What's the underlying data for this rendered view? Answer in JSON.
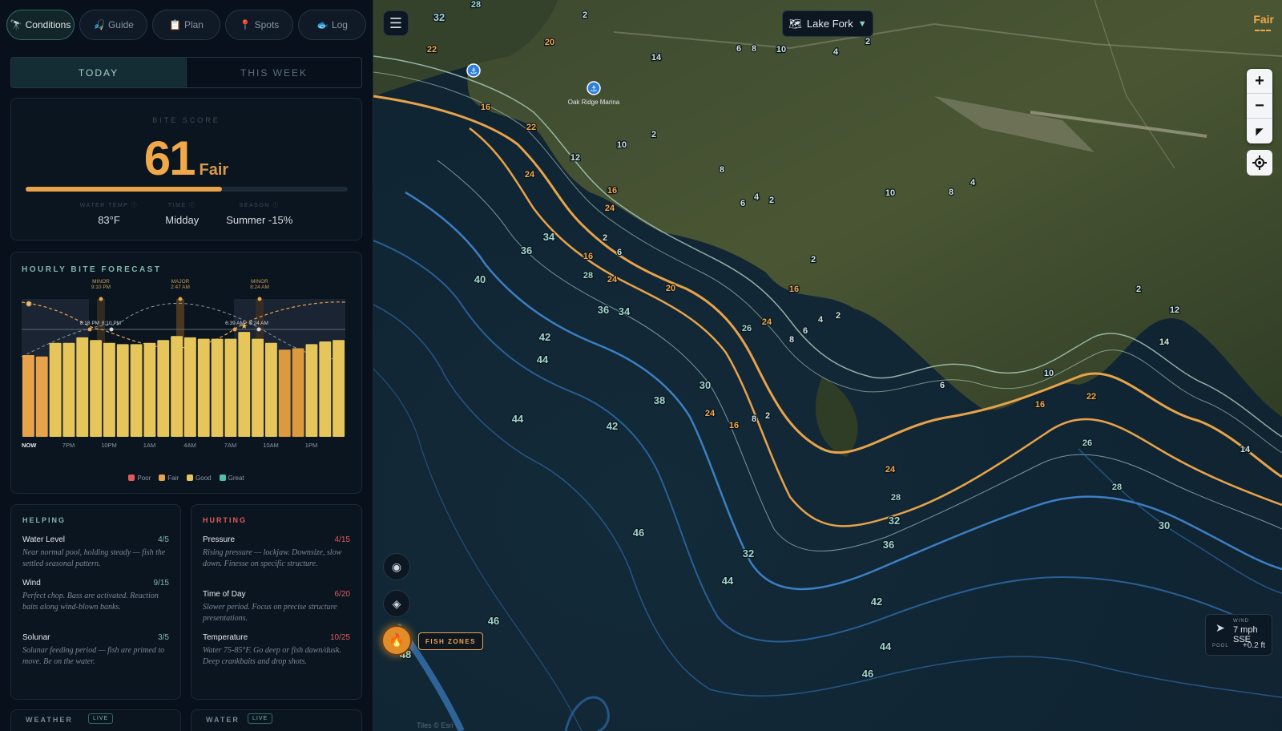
{
  "nav": [
    {
      "label": "Conditions",
      "icon": "🔭",
      "active": true
    },
    {
      "label": "Guide",
      "icon": "🎣",
      "active": false
    },
    {
      "label": "Plan",
      "icon": "📋",
      "active": false
    },
    {
      "label": "Spots",
      "icon": "📍",
      "active": false
    },
    {
      "label": "Log",
      "icon": "🐟",
      "active": false
    }
  ],
  "tabs": {
    "today": "TODAY",
    "week": "THIS WEEK"
  },
  "bite": {
    "label": "BITE SCORE",
    "score": "61",
    "rating": "Fair",
    "progress": 0.61,
    "stats": [
      {
        "key": "WATER TEMP ⓘ",
        "value": "83°F"
      },
      {
        "key": "TIME ⓘ",
        "value": "Midday"
      },
      {
        "key": "SEASON ⓘ",
        "value": "Summer -15%"
      }
    ]
  },
  "forecast": {
    "title": "HOURLY BITE FORECAST",
    "events": [
      {
        "type": "MINOR",
        "time": "9:10 PM"
      },
      {
        "type": "MAJOR",
        "time": "2:47 AM"
      },
      {
        "type": "MINOR",
        "time": "8:24 AM"
      }
    ],
    "sun_labels": [
      "8:18 PM",
      "8:10 PM",
      "6:39 AM",
      "8:24 AM"
    ],
    "x_labels": [
      "NOW",
      "7PM",
      "10PM",
      "1AM",
      "4AM",
      "7AM",
      "10AM",
      "1PM"
    ],
    "legend": [
      {
        "label": "Poor",
        "color": "#e05a5a"
      },
      {
        "label": "Fair",
        "color": "#e8a34a"
      },
      {
        "label": "Good",
        "color": "#e6c65a"
      },
      {
        "label": "Great",
        "color": "#4fc1a6"
      }
    ]
  },
  "chart_data": {
    "type": "bar",
    "title": "HOURLY BITE FORECAST",
    "categories": [
      "NOW",
      "5PM",
      "6PM",
      "7PM",
      "8PM",
      "9PM",
      "10PM",
      "11PM",
      "12AM",
      "1AM",
      "2AM",
      "3AM",
      "4AM",
      "5AM",
      "6AM",
      "7AM",
      "8AM",
      "9AM",
      "10AM",
      "11AM",
      "12PM",
      "1PM",
      "2PM",
      "3PM"
    ],
    "x_tick_labels": [
      "NOW",
      "7PM",
      "10PM",
      "1AM",
      "4AM",
      "7AM",
      "10AM",
      "1PM"
    ],
    "values": [
      60,
      59,
      69,
      69,
      73,
      71,
      69,
      68,
      68,
      69,
      71,
      74,
      73,
      72,
      72,
      72,
      77,
      72,
      69,
      64,
      65,
      68,
      70,
      71
    ],
    "ylim": [
      0,
      100
    ],
    "legend": [
      "Poor",
      "Fair",
      "Good",
      "Great"
    ]
  },
  "helping": {
    "title": "HELPING",
    "items": [
      {
        "name": "Water Level",
        "score": "4/5",
        "desc": "Near normal pool, holding steady — fish the settled seasonal pattern."
      },
      {
        "name": "Wind",
        "score": "9/15",
        "desc": "Perfect chop. Bass are activated. Reaction baits along wind-blown banks."
      },
      {
        "name": "Solunar",
        "score": "3/5",
        "desc": "Solunar feeding period — fish are primed to move. Be on the water."
      }
    ]
  },
  "hurting": {
    "title": "HURTING",
    "items": [
      {
        "name": "Pressure",
        "score": "4/15",
        "desc": "Rising pressure — lockjaw. Downsize, slow down. Finesse on specific structure."
      },
      {
        "name": "Time of Day",
        "score": "6/20",
        "desc": "Slower period. Focus on precise structure presentations."
      },
      {
        "name": "Temperature",
        "score": "10/25",
        "desc": "Water 75-85°F. Go deep or fish dawn/dusk. Deep crankbaits and drop shots."
      }
    ]
  },
  "bottom_cards": [
    {
      "title": "WEATHER",
      "badge": "LIVE"
    },
    {
      "title": "WATER",
      "badge": "LIVE"
    }
  ],
  "map": {
    "lake": "Lake Fork",
    "rating": "Fair",
    "marina": "Oak Ridge Marina",
    "fish_zones": "FISH ZONES",
    "wind_label": "WIND",
    "wind_value": "7 mph SSE",
    "pool_label": "POOL",
    "pool_value": "+0.2 ft",
    "attribution": "Tiles © Esri",
    "depths": [
      {
        "t": "28"
      },
      {
        "t": "32"
      },
      {
        "t": "2"
      },
      {
        "t": "22"
      },
      {
        "t": "20"
      },
      {
        "t": "14"
      },
      {
        "t": "6"
      },
      {
        "t": "8"
      },
      {
        "t": "10"
      },
      {
        "t": "4"
      },
      {
        "t": "2"
      },
      {
        "t": "16"
      },
      {
        "t": "22"
      },
      {
        "t": "12"
      },
      {
        "t": "24"
      },
      {
        "t": "10"
      },
      {
        "t": "2"
      },
      {
        "t": "8"
      },
      {
        "t": "16"
      },
      {
        "t": "24"
      },
      {
        "t": "6"
      },
      {
        "t": "4"
      },
      {
        "t": "2"
      },
      {
        "t": "10"
      },
      {
        "t": "8"
      },
      {
        "t": "4"
      },
      {
        "t": "34"
      },
      {
        "t": "36"
      },
      {
        "t": "2"
      },
      {
        "t": "6"
      },
      {
        "t": "16"
      },
      {
        "t": "28"
      },
      {
        "t": "24"
      },
      {
        "t": "20"
      },
      {
        "t": "16"
      },
      {
        "t": "40"
      },
      {
        "t": "36"
      },
      {
        "t": "34"
      },
      {
        "t": "26"
      },
      {
        "t": "24"
      },
      {
        "t": "6"
      },
      {
        "t": "4"
      },
      {
        "t": "2"
      },
      {
        "t": "8"
      },
      {
        "t": "42"
      },
      {
        "t": "44"
      },
      {
        "t": "2"
      },
      {
        "t": "12"
      },
      {
        "t": "14"
      },
      {
        "t": "2"
      },
      {
        "t": "10"
      },
      {
        "t": "6"
      },
      {
        "t": "30"
      },
      {
        "t": "38"
      },
      {
        "t": "44"
      },
      {
        "t": "42"
      },
      {
        "t": "24"
      },
      {
        "t": "16"
      },
      {
        "t": "8"
      },
      {
        "t": "2"
      },
      {
        "t": "16"
      },
      {
        "t": "22"
      },
      {
        "t": "26"
      },
      {
        "t": "14"
      },
      {
        "t": "24"
      },
      {
        "t": "28"
      },
      {
        "t": "28"
      },
      {
        "t": "32"
      },
      {
        "t": "36"
      },
      {
        "t": "30"
      },
      {
        "t": "46"
      },
      {
        "t": "32"
      },
      {
        "t": "44"
      },
      {
        "t": "42"
      },
      {
        "t": "46"
      },
      {
        "t": "48"
      },
      {
        "t": "44"
      },
      {
        "t": "46"
      }
    ]
  },
  "colors": {
    "accent": "#f0a848",
    "teal": "#7fb8ac",
    "water": "#102330",
    "hurting": "#e05a5a",
    "helping": "#7fb8ac"
  }
}
